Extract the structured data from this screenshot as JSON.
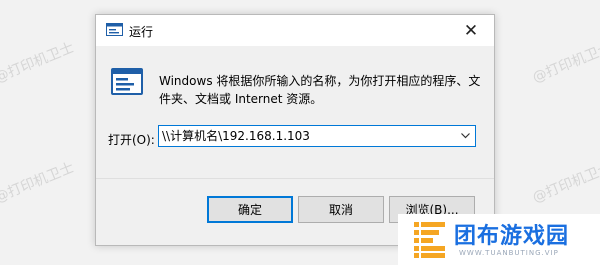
{
  "watermark": {
    "text": "@打印机卫士"
  },
  "dialog": {
    "title": "运行",
    "close_glyph": "✕",
    "description": "Windows 将根据你所输入的名称，为你打开相应的程序、文件夹、文档或 Internet 资源。",
    "open_label": "打开(O):",
    "input_value": "\\\\计算机名\\192.168.1.103",
    "buttons": {
      "ok": "确定",
      "cancel": "取消",
      "browse": "浏览(B)..."
    },
    "icons": {
      "title": "run-app-icon",
      "body": "run-app-icon",
      "dropdown": "chevron-down-icon",
      "close": "close-icon"
    }
  },
  "brand": {
    "name": "团布游戏园",
    "url": "WWW.TUANBUTING.VIP",
    "colors": {
      "primary": "#1a6fe0",
      "accent": "#f5a623"
    }
  }
}
